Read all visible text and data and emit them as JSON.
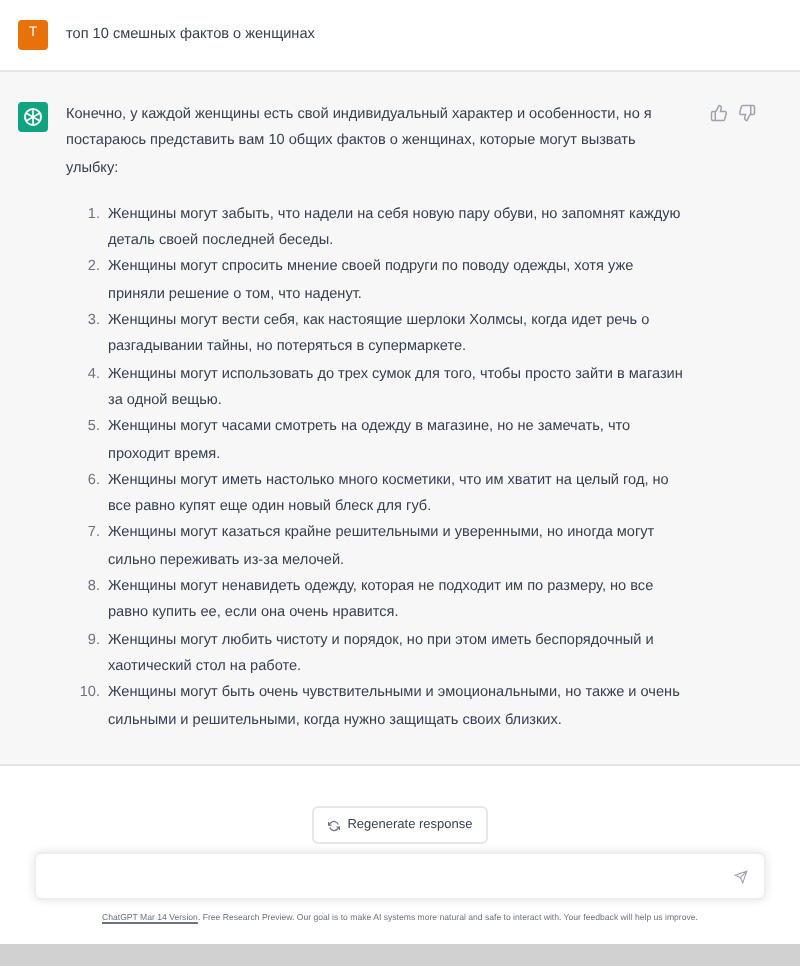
{
  "user_message": {
    "avatar": "T",
    "text": "топ 10 смешных фактов о женщинах"
  },
  "assistant_message": {
    "intro": "Конечно, у каждой женщины есть свой индивидуальный характер и особенности, но я постараюсь представить вам 10 общих фактов о женщинах, которые могут вызвать улыбку:",
    "items": [
      {
        "number": "1.",
        "text": "Женщины могут забыть, что надели на себя новую пару обуви, но запомнят каждую деталь своей последней беседы."
      },
      {
        "number": "2.",
        "text": "Женщины могут спросить мнение своей подруги по поводу одежды, хотя уже приняли решение о том, что наденут."
      },
      {
        "number": "3.",
        "text": "Женщины могут вести себя, как настоящие шерлоки Холмсы, когда идет речь о разгадывании тайны, но потеряться в супермаркете."
      },
      {
        "number": "4.",
        "text": "Женщины могут использовать до трех сумок для того, чтобы просто зайти в магазин за одной вещью."
      },
      {
        "number": "5.",
        "text": "Женщины могут часами смотреть на одежду в магазине, но не замечать, что проходит время."
      },
      {
        "number": "6.",
        "text": "Женщины могут иметь настолько много косметики, что им хватит на целый год, но все равно купят еще один новый блеск для губ."
      },
      {
        "number": "7.",
        "text": "Женщины могут казаться крайне решительными и уверенными, но иногда могут сильно переживать из-за мелочей."
      },
      {
        "number": "8.",
        "text": "Женщины могут ненавидеть одежду, которая не подходит им по размеру, но все равно купить ее, если она очень нравится."
      },
      {
        "number": "9.",
        "text": "Женщины могут любить чистоту и порядок, но при этом иметь беспорядочный и хаотический стол на работе."
      },
      {
        "number": "10.",
        "text": "Женщины могут быть очень чувствительными и эмоциональными, но также и очень сильными и решительными, когда нужно защищать своих близких."
      }
    ]
  },
  "regenerate_button": "Regenerate response",
  "footer": {
    "link": "ChatGPT Mar 14 Version",
    "text": ". Free Research Preview. Our goal is to make AI systems more natural and safe to interact with. Your feedback will help us improve."
  }
}
